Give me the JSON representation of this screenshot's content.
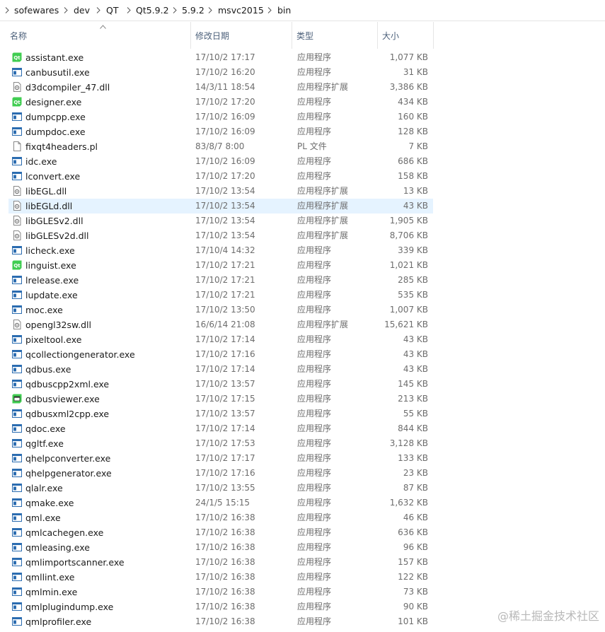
{
  "breadcrumb": [
    "sofewares",
    "dev",
    "QT",
    "Qt5.9.2",
    "5.9.2",
    "msvc2015",
    "bin"
  ],
  "columns": {
    "name": "名称",
    "date": "修改日期",
    "type": "类型",
    "size": "大小"
  },
  "files": [
    {
      "name": "assistant.exe",
      "date": "17/10/2 17:17",
      "type": "应用程序",
      "size": "1,077 KB",
      "icon": "qt-app-icon"
    },
    {
      "name": "canbusutil.exe",
      "date": "17/10/2 16:20",
      "type": "应用程序",
      "size": "31 KB",
      "icon": "exe-icon"
    },
    {
      "name": "d3dcompiler_47.dll",
      "date": "14/3/11 18:54",
      "type": "应用程序扩展",
      "size": "3,386 KB",
      "icon": "dll-icon"
    },
    {
      "name": "designer.exe",
      "date": "17/10/2 17:20",
      "type": "应用程序",
      "size": "434 KB",
      "icon": "qt-app-icon"
    },
    {
      "name": "dumpcpp.exe",
      "date": "17/10/2 16:09",
      "type": "应用程序",
      "size": "160 KB",
      "icon": "exe-icon"
    },
    {
      "name": "dumpdoc.exe",
      "date": "17/10/2 16:09",
      "type": "应用程序",
      "size": "128 KB",
      "icon": "exe-icon"
    },
    {
      "name": "fixqt4headers.pl",
      "date": "83/8/7 8:00",
      "type": "PL 文件",
      "size": "7 KB",
      "icon": "file-icon"
    },
    {
      "name": "idc.exe",
      "date": "17/10/2 16:09",
      "type": "应用程序",
      "size": "686 KB",
      "icon": "exe-icon"
    },
    {
      "name": "lconvert.exe",
      "date": "17/10/2 17:20",
      "type": "应用程序",
      "size": "158 KB",
      "icon": "exe-icon"
    },
    {
      "name": "libEGL.dll",
      "date": "17/10/2 13:54",
      "type": "应用程序扩展",
      "size": "13 KB",
      "icon": "dll-icon"
    },
    {
      "name": "libEGLd.dll",
      "date": "17/10/2 13:54",
      "type": "应用程序扩展",
      "size": "43 KB",
      "icon": "dll-icon",
      "selected": true
    },
    {
      "name": "libGLESv2.dll",
      "date": "17/10/2 13:54",
      "type": "应用程序扩展",
      "size": "1,905 KB",
      "icon": "dll-icon"
    },
    {
      "name": "libGLESv2d.dll",
      "date": "17/10/2 13:54",
      "type": "应用程序扩展",
      "size": "8,706 KB",
      "icon": "dll-icon"
    },
    {
      "name": "licheck.exe",
      "date": "17/10/4 14:32",
      "type": "应用程序",
      "size": "339 KB",
      "icon": "exe-icon"
    },
    {
      "name": "linguist.exe",
      "date": "17/10/2 17:21",
      "type": "应用程序",
      "size": "1,021 KB",
      "icon": "qt-app-icon"
    },
    {
      "name": "lrelease.exe",
      "date": "17/10/2 17:21",
      "type": "应用程序",
      "size": "285 KB",
      "icon": "exe-icon"
    },
    {
      "name": "lupdate.exe",
      "date": "17/10/2 17:21",
      "type": "应用程序",
      "size": "535 KB",
      "icon": "exe-icon"
    },
    {
      "name": "moc.exe",
      "date": "17/10/2 13:50",
      "type": "应用程序",
      "size": "1,007 KB",
      "icon": "exe-icon"
    },
    {
      "name": "opengl32sw.dll",
      "date": "16/6/14 21:08",
      "type": "应用程序扩展",
      "size": "15,621 KB",
      "icon": "dll-icon"
    },
    {
      "name": "pixeltool.exe",
      "date": "17/10/2 17:14",
      "type": "应用程序",
      "size": "43 KB",
      "icon": "exe-icon"
    },
    {
      "name": "qcollectiongenerator.exe",
      "date": "17/10/2 17:16",
      "type": "应用程序",
      "size": "43 KB",
      "icon": "exe-icon"
    },
    {
      "name": "qdbus.exe",
      "date": "17/10/2 17:14",
      "type": "应用程序",
      "size": "43 KB",
      "icon": "exe-icon"
    },
    {
      "name": "qdbuscpp2xml.exe",
      "date": "17/10/2 13:57",
      "type": "应用程序",
      "size": "145 KB",
      "icon": "exe-icon"
    },
    {
      "name": "qdbusviewer.exe",
      "date": "17/10/2 17:15",
      "type": "应用程序",
      "size": "213 KB",
      "icon": "qt-viewer-icon"
    },
    {
      "name": "qdbusxml2cpp.exe",
      "date": "17/10/2 13:57",
      "type": "应用程序",
      "size": "55 KB",
      "icon": "exe-icon"
    },
    {
      "name": "qdoc.exe",
      "date": "17/10/2 17:14",
      "type": "应用程序",
      "size": "844 KB",
      "icon": "exe-icon"
    },
    {
      "name": "qgltf.exe",
      "date": "17/10/2 17:53",
      "type": "应用程序",
      "size": "3,128 KB",
      "icon": "exe-icon"
    },
    {
      "name": "qhelpconverter.exe",
      "date": "17/10/2 17:17",
      "type": "应用程序",
      "size": "133 KB",
      "icon": "exe-icon"
    },
    {
      "name": "qhelpgenerator.exe",
      "date": "17/10/2 17:16",
      "type": "应用程序",
      "size": "23 KB",
      "icon": "exe-icon"
    },
    {
      "name": "qlalr.exe",
      "date": "17/10/2 13:55",
      "type": "应用程序",
      "size": "87 KB",
      "icon": "exe-icon"
    },
    {
      "name": "qmake.exe",
      "date": "24/1/5 15:15",
      "type": "应用程序",
      "size": "1,632 KB",
      "icon": "exe-icon"
    },
    {
      "name": "qml.exe",
      "date": "17/10/2 16:38",
      "type": "应用程序",
      "size": "46 KB",
      "icon": "exe-icon"
    },
    {
      "name": "qmlcachegen.exe",
      "date": "17/10/2 16:38",
      "type": "应用程序",
      "size": "636 KB",
      "icon": "exe-icon"
    },
    {
      "name": "qmleasing.exe",
      "date": "17/10/2 16:38",
      "type": "应用程序",
      "size": "96 KB",
      "icon": "exe-icon"
    },
    {
      "name": "qmlimportscanner.exe",
      "date": "17/10/2 16:38",
      "type": "应用程序",
      "size": "157 KB",
      "icon": "exe-icon"
    },
    {
      "name": "qmllint.exe",
      "date": "17/10/2 16:38",
      "type": "应用程序",
      "size": "122 KB",
      "icon": "exe-icon"
    },
    {
      "name": "qmlmin.exe",
      "date": "17/10/2 16:38",
      "type": "应用程序",
      "size": "73 KB",
      "icon": "exe-icon"
    },
    {
      "name": "qmlplugindump.exe",
      "date": "17/10/2 16:38",
      "type": "应用程序",
      "size": "90 KB",
      "icon": "exe-icon"
    },
    {
      "name": "qmlprofiler.exe",
      "date": "17/10/2 16:38",
      "type": "应用程序",
      "size": "101 KB",
      "icon": "exe-icon"
    }
  ],
  "watermark": "@稀土掘金技术社区"
}
